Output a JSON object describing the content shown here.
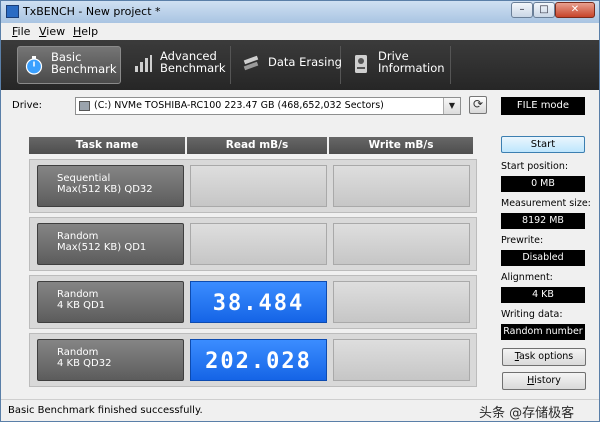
{
  "window": {
    "title": "TxBENCH - New project *",
    "minimize_glyph": "–",
    "maximize_glyph": "□",
    "close_glyph": "✕"
  },
  "menu": {
    "items": [
      {
        "accel": "F",
        "rest": "ile"
      },
      {
        "accel": "V",
        "rest": "iew"
      },
      {
        "accel": "H",
        "rest": "elp"
      }
    ]
  },
  "toolbar": {
    "tabs": [
      {
        "label": "Basic\nBenchmark",
        "icon": "stopwatch-icon",
        "active": true
      },
      {
        "label": "Advanced\nBenchmark",
        "icon": "bar-chart-icon",
        "active": false
      },
      {
        "label": "Data Erasing",
        "icon": "eraser-icon",
        "active": false
      },
      {
        "label": "Drive\nInformation",
        "icon": "drive-info-icon",
        "active": false
      }
    ]
  },
  "drive": {
    "label": "Drive:",
    "selected": "(C:) NVMe TOSHIBA-RC100  223.47 GB (468,652,032 Sectors)",
    "mode": "FILE mode"
  },
  "table": {
    "headers": {
      "task": "Task name",
      "read": "Read mB/s",
      "write": "Write mB/s"
    },
    "rows": [
      {
        "name_line1": "Sequential",
        "name_line2": "Max(512 KB) QD32",
        "read": "",
        "write": ""
      },
      {
        "name_line1": "Random",
        "name_line2": "Max(512 KB) QD1",
        "read": "",
        "write": ""
      },
      {
        "name_line1": "Random",
        "name_line2": "4 KB QD1",
        "read": "38.484",
        "write": ""
      },
      {
        "name_line1": "Random",
        "name_line2": "4 KB QD32",
        "read": "202.028",
        "write": ""
      }
    ]
  },
  "panel": {
    "start_label": "Start",
    "start_position_label": "Start position:",
    "start_position": "0 MB",
    "measurement_size_label": "Measurement size:",
    "measurement_size": "8192 MB",
    "prewrite_label": "Prewrite:",
    "prewrite": "Disabled",
    "alignment_label": "Alignment:",
    "alignment": "4 KB",
    "writing_data_label": "Writing data:",
    "writing_data": "Random number",
    "task_options": {
      "accel": "T",
      "rest": "ask options"
    },
    "history": {
      "accel": "H",
      "rest": "istory"
    }
  },
  "status": {
    "text": "Basic Benchmark finished successfully.",
    "watermark": "头条 @存储极客"
  },
  "colors": {
    "toolbar_bg": "#2e2e2e",
    "result_blue": "#1f6ff0",
    "cell_gray": "#d0d0d0"
  }
}
